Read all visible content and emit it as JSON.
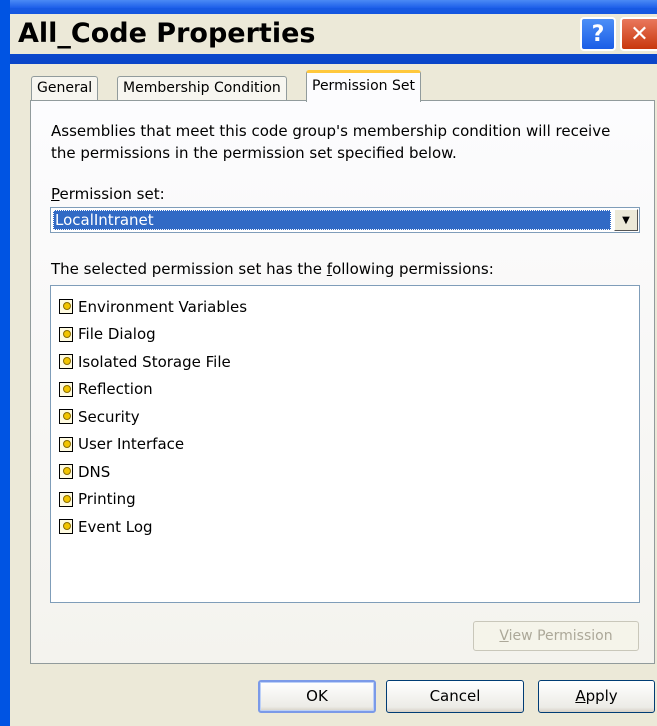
{
  "window": {
    "title": "All_Code Properties",
    "help_glyph": "?",
    "close_glyph": "✕"
  },
  "tabs": [
    {
      "label": "General",
      "active": false
    },
    {
      "label": "Membership Condition",
      "active": false
    },
    {
      "label": "Permission Set",
      "active": true
    }
  ],
  "description": "Assemblies that meet this code group's membership condition will receive the permissions in the permission set specified below.",
  "permission_set": {
    "label_prefix": "P",
    "label_rest": "ermission set:",
    "selected": "LocalIntranet",
    "arrow": "▼"
  },
  "permissions_label": {
    "before": "The selected permission set has the ",
    "accel": "f",
    "after": "ollowing permissions:"
  },
  "permissions": [
    "Environment Variables",
    "File Dialog",
    "Isolated Storage File",
    "Reflection",
    "Security",
    "User Interface",
    "DNS",
    "Printing",
    "Event Log"
  ],
  "buttons": {
    "view_permission_accel": "V",
    "view_permission_rest": "iew Permission",
    "ok": "OK",
    "cancel": "Cancel",
    "apply_accel": "A",
    "apply_rest": "pply"
  },
  "colors": {
    "title_bar": "#0e50d8",
    "dialog_face": "#ece9d8",
    "selection": "#316ac5",
    "active_tab_accent": "#ffc83c"
  }
}
